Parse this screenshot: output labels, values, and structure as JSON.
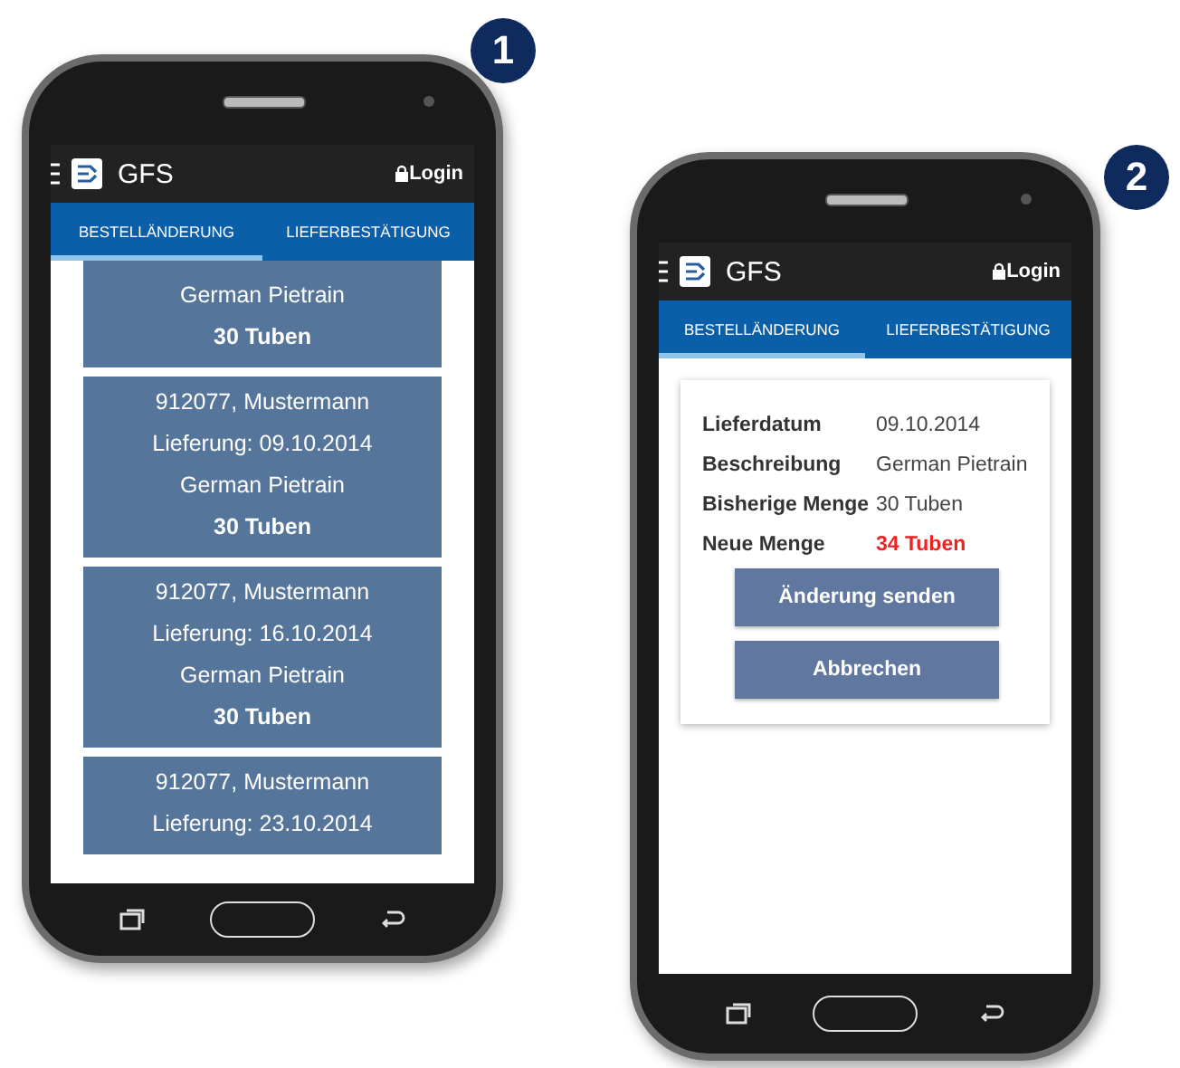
{
  "phones": [
    {
      "kind": "list",
      "badge": "1",
      "app_bar": {
        "title": "GFS",
        "login": "Login"
      },
      "tabs": [
        {
          "label": "BESTELLÄNDERUNG",
          "selected": true
        },
        {
          "label": "LIEFERBESTÄTIGUNG",
          "selected": false
        }
      ],
      "orders": [
        {
          "lines": [
            "German Pietrain"
          ],
          "quantity": "30 Tuben"
        },
        {
          "lines": [
            "912077, Mustermann",
            "Lieferung: 09.10.2014",
            "German Pietrain"
          ],
          "quantity": "30 Tuben"
        },
        {
          "lines": [
            "912077, Mustermann",
            "Lieferung: 16.10.2014",
            "German Pietrain"
          ],
          "quantity": "30 Tuben"
        },
        {
          "lines": [
            "912077, Mustermann",
            "Lieferung: 23.10.2014"
          ]
        }
      ]
    },
    {
      "kind": "detail",
      "badge": "2",
      "app_bar": {
        "title": "GFS",
        "login": "Login"
      },
      "tabs": [
        {
          "label": "BESTELLÄNDERUNG",
          "selected": true
        },
        {
          "label": "LIEFERBESTÄTIGUNG",
          "selected": false
        }
      ],
      "details": [
        {
          "label": "Lieferdatum",
          "value": "09.10.2014",
          "highlight": false
        },
        {
          "label": "Beschreibung",
          "value": "German Pietrain",
          "highlight": false
        },
        {
          "label": "Bisherige Menge",
          "value": "30 Tuben",
          "highlight": false
        },
        {
          "label": "Neue Menge",
          "value": "34 Tuben",
          "highlight": true
        }
      ],
      "buttons": [
        "Änderung senden",
        "Abbrechen"
      ]
    }
  ]
}
